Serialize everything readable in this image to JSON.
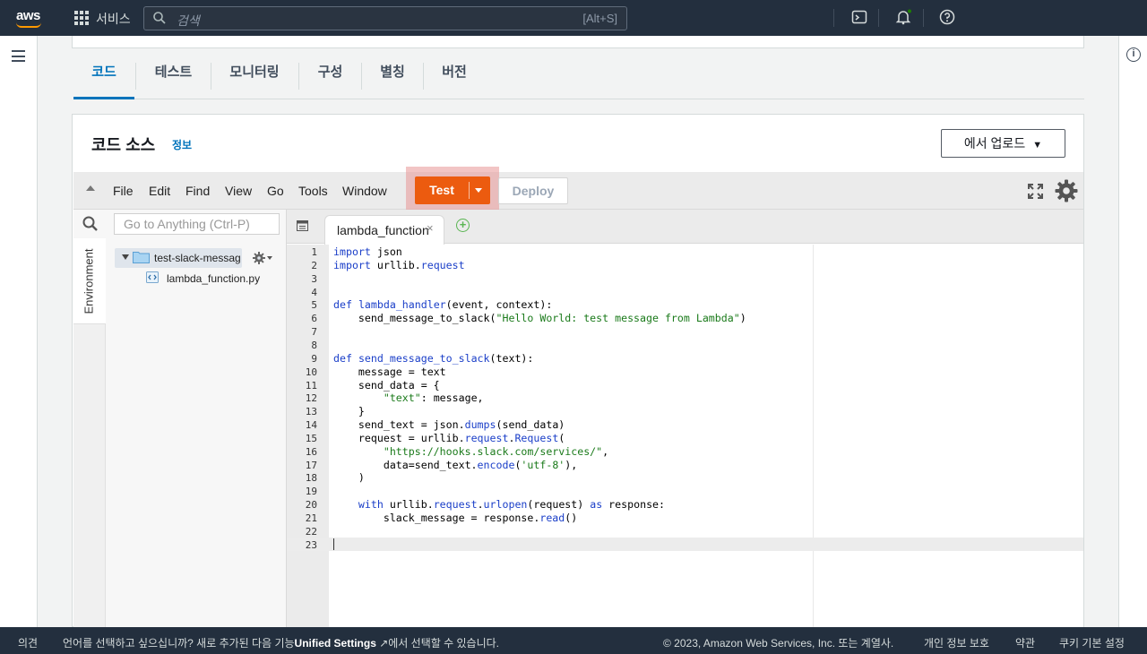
{
  "nav": {
    "logo": "aws",
    "services": "서비스",
    "search_placeholder": "검색",
    "search_shortcut": "[Alt+S]",
    "icons": [
      "cloudshell-icon",
      "bell-icon",
      "help-icon"
    ]
  },
  "tabs": [
    "코드",
    "테스트",
    "모니터링",
    "구성",
    "별칭",
    "버전"
  ],
  "card": {
    "title": "코드 소스",
    "info": "정보",
    "upload_button": "에서 업로드"
  },
  "ide": {
    "menu": [
      "File",
      "Edit",
      "Find",
      "View",
      "Go",
      "Tools",
      "Window"
    ],
    "test_button": "Test",
    "deploy_button": "Deploy",
    "search_placeholder": "Go to Anything (Ctrl-P)",
    "environment_label": "Environment",
    "folder_name": "test-slack-messages",
    "file_name": "lambda_function.py",
    "active_tab": "lambda_function",
    "tab_close": "×",
    "add_tab": "+"
  },
  "code_lines": [
    "import json",
    "import urllib.request",
    "",
    "",
    "def lambda_handler(event, context):",
    "    send_message_to_slack(\"Hello World: test message from Lambda\")",
    "",
    "",
    "def send_message_to_slack(text):",
    "    message = text",
    "    send_data = {",
    "        \"text\": message,",
    "    }",
    "    send_text = json.dumps(send_data)",
    "    request = urllib.request.Request(",
    "        \"https://hooks.slack.com/services/\",",
    "        data=send_text.encode('utf-8'),",
    "    )",
    "",
    "    with urllib.request.urlopen(request) as response:",
    "        slack_message = response.read()",
    "",
    ""
  ],
  "footer": {
    "feedback": "의견",
    "language_prompt": "언어를 선택하고 싶으십니까? 새로 추가된 다음 기능",
    "unified_settings": "Unified Settings",
    "language_suffix": "에서 선택할 수 있습니다.",
    "copyright": "© 2023, Amazon Web Services, Inc. 또는 계열사.",
    "privacy": "개인 정보 보호",
    "terms": "약관",
    "cookies": "쿠키 기본 설정"
  },
  "colors": {
    "nav_bg": "#232f3e",
    "accent_blue": "#0073bb",
    "test_orange": "#ec5b0f",
    "highlight": "#e89696"
  }
}
